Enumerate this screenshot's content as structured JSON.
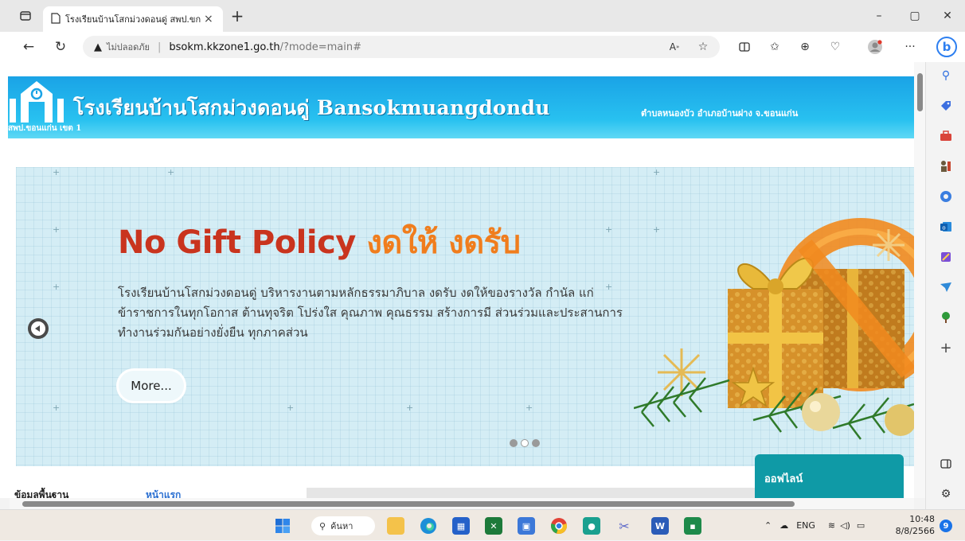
{
  "browser": {
    "tab_title": "โรงเรียนบ้านโสกม่วงดอนดู่ สพป.ขก.1",
    "tab_close": "×",
    "new_tab": "+",
    "window_controls": {
      "minimize": "–",
      "maximize": "▢",
      "close": "✕"
    }
  },
  "address_bar": {
    "security_label": "ไม่ปลอดภัย",
    "separator": "|",
    "host": "bsokm.kkzone1.go.th",
    "path": "/?mode=main#"
  },
  "page": {
    "header": {
      "school_name": "โรงเรียนบ้านโสกม่วงดอนดู่ Bansokmuangdondu",
      "location": "ตำบลหนองบัว อำเภอบ้านฝาง จ.ขอนแก่น",
      "area": "สพป.ขอนแก่น เขต 1"
    },
    "slide": {
      "title_en": "No Gift Policy",
      "title_th": "งดให้ งดรับ",
      "body": "โรงเรียนบ้านโสกม่วงดอนดู่ บริหารงานตามหลักธรรมาภิบาล งดรับ งดให้ของรางวัล กำนัล แก่ข้าราชการในทุกโอกาส ต้านทุจริต โปร่งใส คุณภาพ คุณธรรม สร้างการมี ส่วนร่วมและประสานการทำงานร่วมกันอย่างยั่งยืน ทุกภาคส่วน",
      "more_label": "More...",
      "active_dot_index": 1,
      "dot_count": 3
    },
    "offline_label": "ออฟไลน์",
    "below_left": "ข้อมูลพื้นฐาน",
    "below_right": "หน้าแรก"
  },
  "taskbar": {
    "search_label": "ค้นหา",
    "lang": "ENG",
    "time": "10:48",
    "date": "8/8/2566",
    "notification_count": "9"
  },
  "colors": {
    "header_blue": "#1aa3e6",
    "title_red": "#c9341e",
    "title_orange": "#f07d1d",
    "offline_teal": "#0f9aa6"
  }
}
